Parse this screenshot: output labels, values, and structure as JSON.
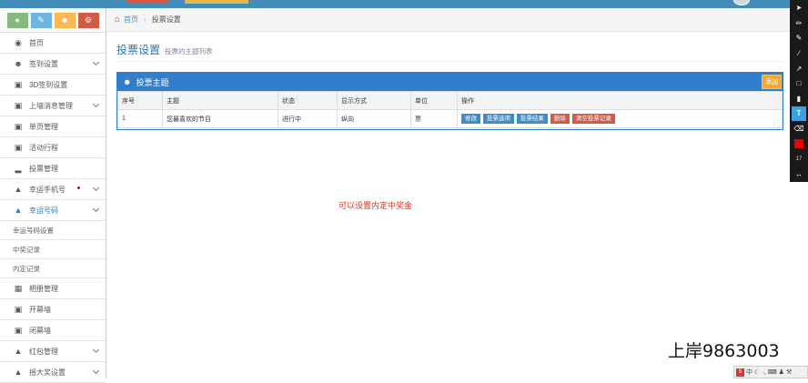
{
  "sidebar": {
    "nav": [
      {
        "label": "首页",
        "icon": "dashboard-icon",
        "chevron": false
      },
      {
        "label": "签到设置",
        "icon": "users-icon",
        "chevron": true
      },
      {
        "label": "3D签到设置",
        "icon": "desktop-icon",
        "chevron": false
      },
      {
        "label": "上墙消息管理",
        "icon": "desktop-icon",
        "chevron": true
      },
      {
        "label": "单页管理",
        "icon": "desktop-icon",
        "chevron": false
      },
      {
        "label": "活动行程",
        "icon": "desktop-icon",
        "chevron": false
      },
      {
        "label": "投票管理",
        "icon": "bar-chart-icon",
        "chevron": false
      },
      {
        "label": "幸运手机号",
        "icon": "gift-icon",
        "chevron": true
      },
      {
        "label": "幸运号码",
        "icon": "gift-icon",
        "chevron": true
      },
      {
        "label": "相册管理",
        "icon": "picture-icon",
        "chevron": false
      },
      {
        "label": "开幕墙",
        "icon": "desktop-icon",
        "chevron": false
      },
      {
        "label": "闭幕墙",
        "icon": "desktop-icon",
        "chevron": false
      },
      {
        "label": "红包管理",
        "icon": "gift-icon",
        "chevron": true
      },
      {
        "label": "摇大奖设置",
        "icon": "gift-icon",
        "chevron": true
      }
    ],
    "sub": [
      "幸运号码设置",
      "中奖记录",
      "内定记录"
    ]
  },
  "breadcrumb": {
    "home": "首页",
    "current": "投票设置"
  },
  "page": {
    "title": "投票设置",
    "subtitle": "投票的主题列表"
  },
  "widget": {
    "title": "投票主题",
    "add_label": "添加"
  },
  "table": {
    "headers": [
      "序号",
      "主题",
      "状态",
      "显示方式",
      "单位",
      "操作"
    ],
    "rows": [
      {
        "id": "1",
        "topic": "您最喜欢的节目",
        "status": "进行中",
        "display": "纵向",
        "unit": "票",
        "actions": [
          "修改",
          "投票选项",
          "投票结果",
          "删除",
          "清空投票记录"
        ]
      }
    ]
  },
  "note": "可以设置内定中奖金",
  "watermark": "上岸9863003",
  "toolbar": {
    "size": "17"
  },
  "ime": {
    "label": "中"
  }
}
